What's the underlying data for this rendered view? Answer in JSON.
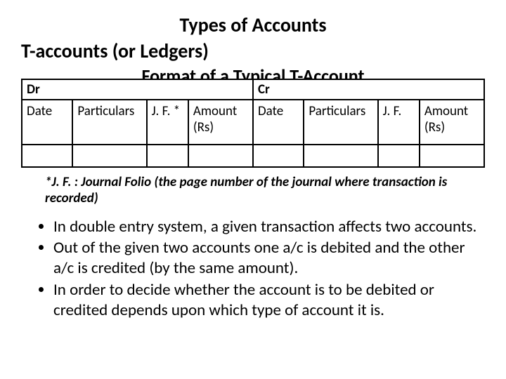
{
  "title": "Types of Accounts",
  "subtitle": "T-accounts (or Ledgers)",
  "format_title": "Format of a Typical T-Account",
  "header": {
    "dr": "Dr",
    "cr": "Cr"
  },
  "cols": {
    "l_date": "Date",
    "l_part": "Particulars",
    "l_jf": "J. F. *",
    "l_amt": "Amount (Rs)",
    "r_date": "Date",
    "r_part": "Particulars",
    "r_jf": "J. F.",
    "r_amt": "Amount (Rs)"
  },
  "footnote": "*J. F. : Journal Folio (the page number of the journal where transaction is recorded)",
  "bullets": [
    "In double entry system, a given transaction affects two accounts.",
    "Out of the given two accounts one a/c is debited and the other a/c is credited (by the same amount).",
    "In order to decide whether the account is to be debited or credited depends upon which type of account it is."
  ]
}
